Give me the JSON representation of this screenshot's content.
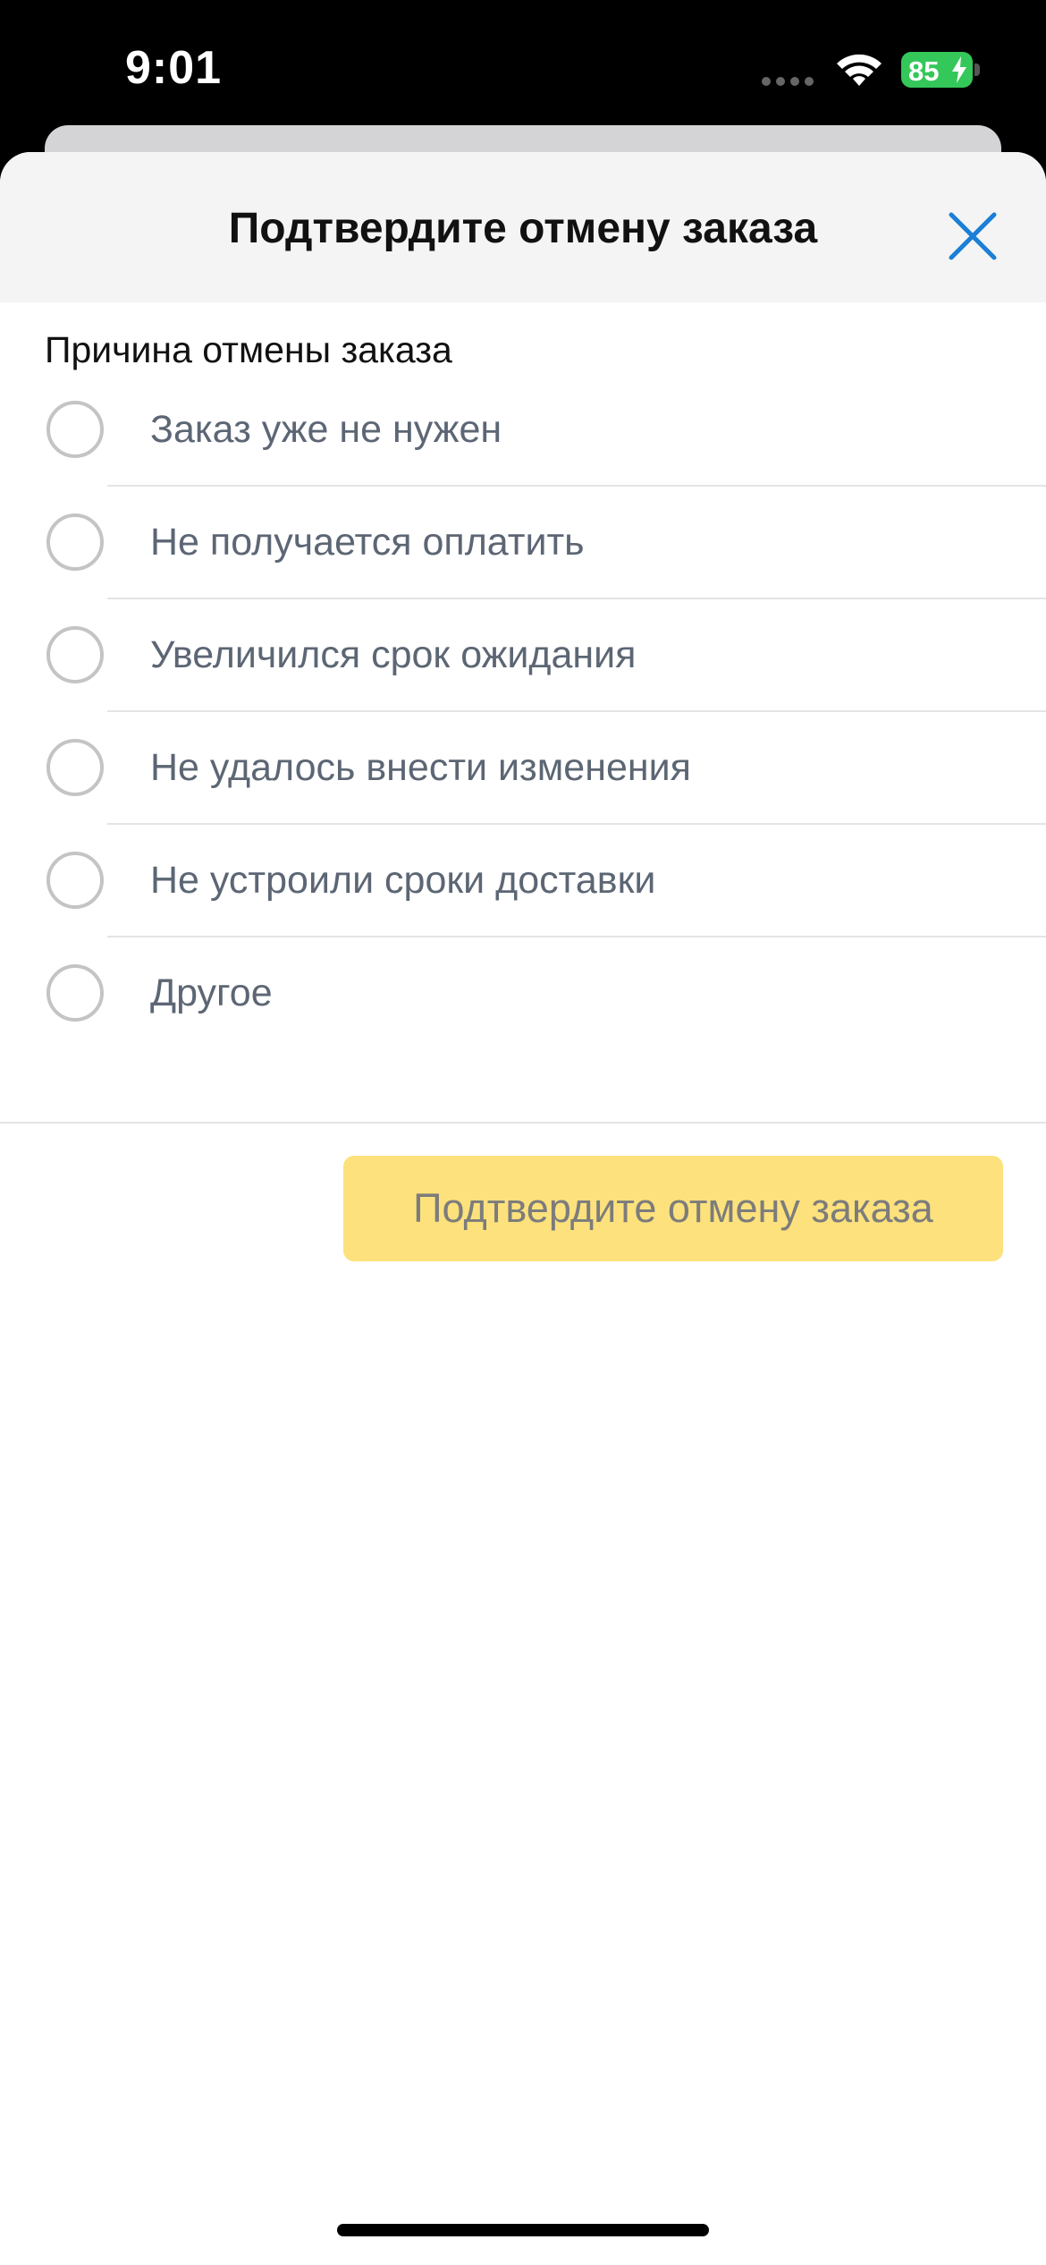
{
  "status_bar": {
    "time": "9:01",
    "battery_level": "85",
    "battery_color": "#34c759",
    "icons": [
      "signal-icon",
      "wifi-icon",
      "battery-charging-icon"
    ]
  },
  "sheet": {
    "title": "Подтвердите отмену заказа",
    "close_icon": "close-icon",
    "accent_color": "#1a7fd6"
  },
  "reason": {
    "label": "Причина отмены заказа",
    "options": [
      {
        "label": "Заказ уже не нужен",
        "selected": false
      },
      {
        "label": "Не получается оплатить",
        "selected": false
      },
      {
        "label": "Увеличился срок ожидания",
        "selected": false
      },
      {
        "label": "Не удалось внести изменения",
        "selected": false
      },
      {
        "label": "Не устроили сроки доставки",
        "selected": false
      },
      {
        "label": "Другое",
        "selected": false
      }
    ]
  },
  "footer": {
    "confirm_label": "Подтвердите отмену заказа",
    "confirm_color": "#fde17c",
    "confirm_enabled": false
  }
}
